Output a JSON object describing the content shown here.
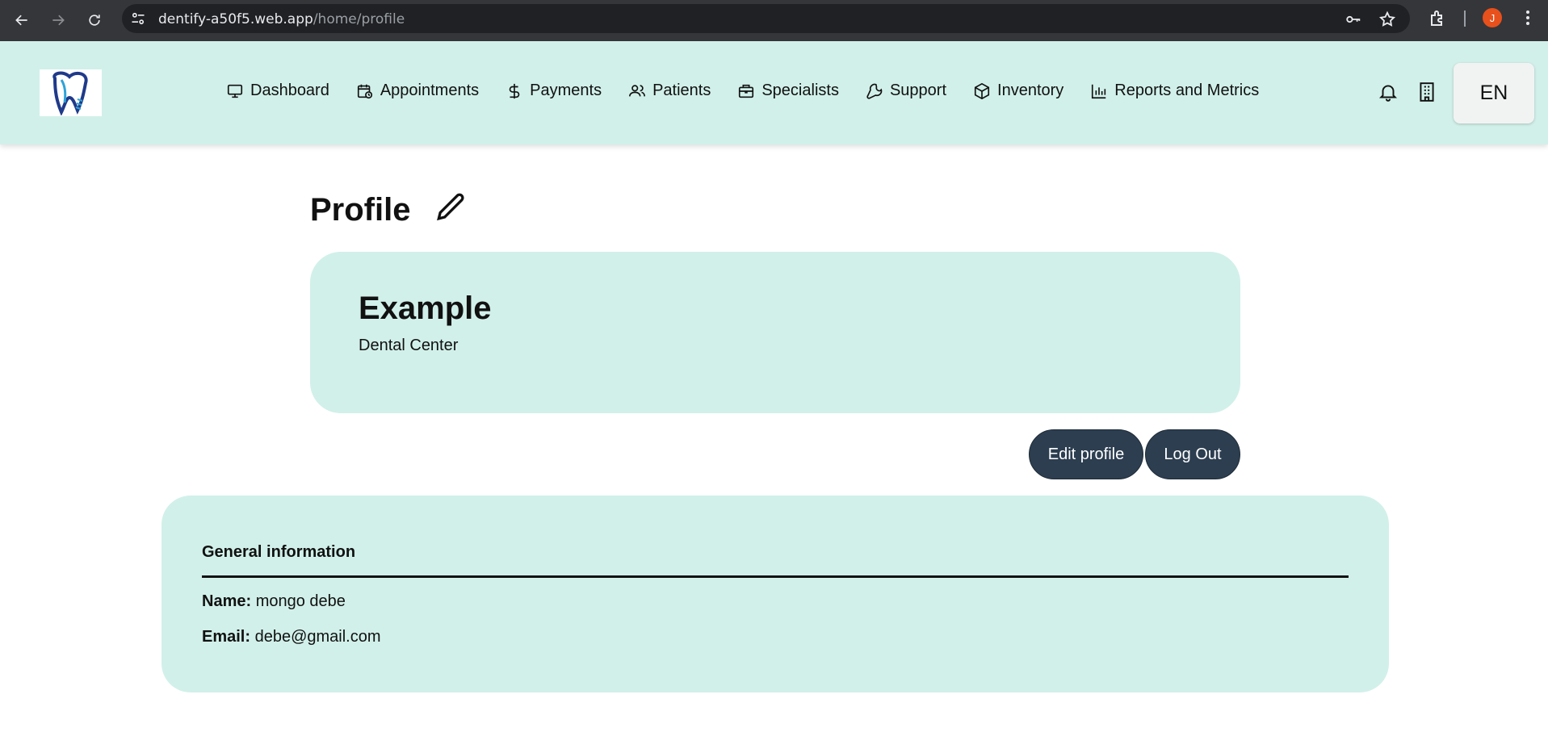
{
  "browser": {
    "url_host": "dentify-a50f5.web.app",
    "url_path": "/home/profile",
    "profile_initial": "J",
    "icons": [
      "back-arrow-icon",
      "forward-arrow-icon",
      "reload-icon",
      "site-settings-icon",
      "password-key-icon",
      "bookmark-star-icon",
      "extensions-icon",
      "kebab-menu-icon"
    ]
  },
  "header": {
    "logo": "dentify-tooth-logo",
    "menu": [
      {
        "label": "Dashboard",
        "icon": "monitor-icon"
      },
      {
        "label": "Appointments",
        "icon": "calendar-clock-icon"
      },
      {
        "label": "Payments",
        "icon": "dollar-icon"
      },
      {
        "label": "Patients",
        "icon": "users-icon"
      },
      {
        "label": "Specialists",
        "icon": "briefcase-icon"
      },
      {
        "label": "Support",
        "icon": "wrench-icon"
      },
      {
        "label": "Inventory",
        "icon": "box-icon"
      },
      {
        "label": "Reports and Metrics",
        "icon": "bar-chart-icon"
      }
    ],
    "language": "EN"
  },
  "profile": {
    "title": "Profile",
    "clinic_name": "Example",
    "clinic_type": "Dental Center",
    "edit_label": "Edit profile",
    "logout_label": "Log Out"
  },
  "general_info": {
    "heading": "General information",
    "name_label": "Name:",
    "name_value": "mongo debe",
    "email_label": "Email:",
    "email_value": "debe@gmail.com"
  },
  "colors": {
    "accent_bg": "#d1f0e9",
    "button_dark": "#2c3e50",
    "chrome_dark": "#35363a"
  }
}
